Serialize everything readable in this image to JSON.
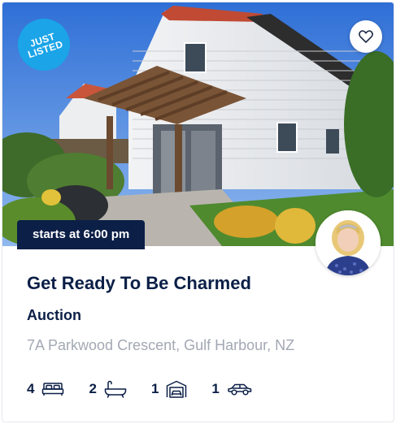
{
  "listing": {
    "badge": "JUST LISTED",
    "time": "starts at 6:00 pm",
    "title": "Get Ready To Be Charmed",
    "sale_type": "Auction",
    "address": "7A Parkwood Crescent, Gulf Harbour, NZ",
    "features": {
      "bedrooms": "4",
      "bathrooms": "2",
      "garages": "1",
      "parking": "1"
    }
  },
  "colors": {
    "navy": "#0b1f47",
    "badge_blue": "#1ba4e8",
    "address_gray": "#a3a8b3"
  },
  "icons": [
    "heart-icon",
    "bed-icon",
    "bath-icon",
    "garage-icon",
    "car-icon"
  ]
}
